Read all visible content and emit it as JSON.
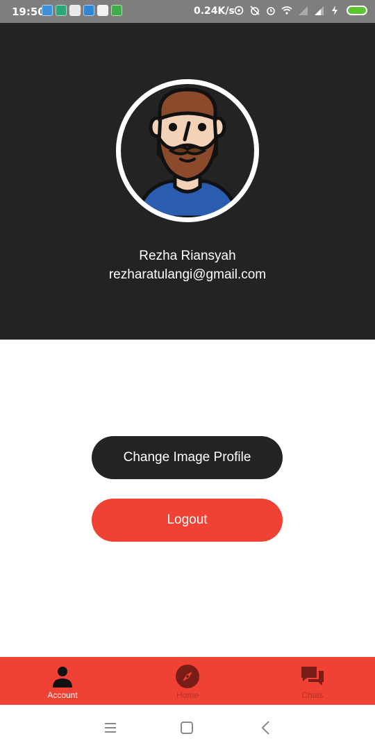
{
  "status_bar": {
    "time": "19:50",
    "network_speed": "0.24K/s",
    "battery_color": "#5cc331"
  },
  "profile": {
    "name": "Rezha Riansyah",
    "email": "rezharatulangi@gmail.com",
    "avatar_icon": "bearded-man-avatar"
  },
  "actions": {
    "change_image_label": "Change Image Profile",
    "logout_label": "Logout"
  },
  "bottom_nav": {
    "active": "Account",
    "items": [
      {
        "label": "Account",
        "icon": "person-icon"
      },
      {
        "label": "Home",
        "icon": "compass-icon"
      },
      {
        "label": "Chats",
        "icon": "chat-bubbles-icon"
      }
    ]
  },
  "colors": {
    "header_bg": "#232323",
    "accent": "#f04135",
    "dark_button": "#232323"
  }
}
